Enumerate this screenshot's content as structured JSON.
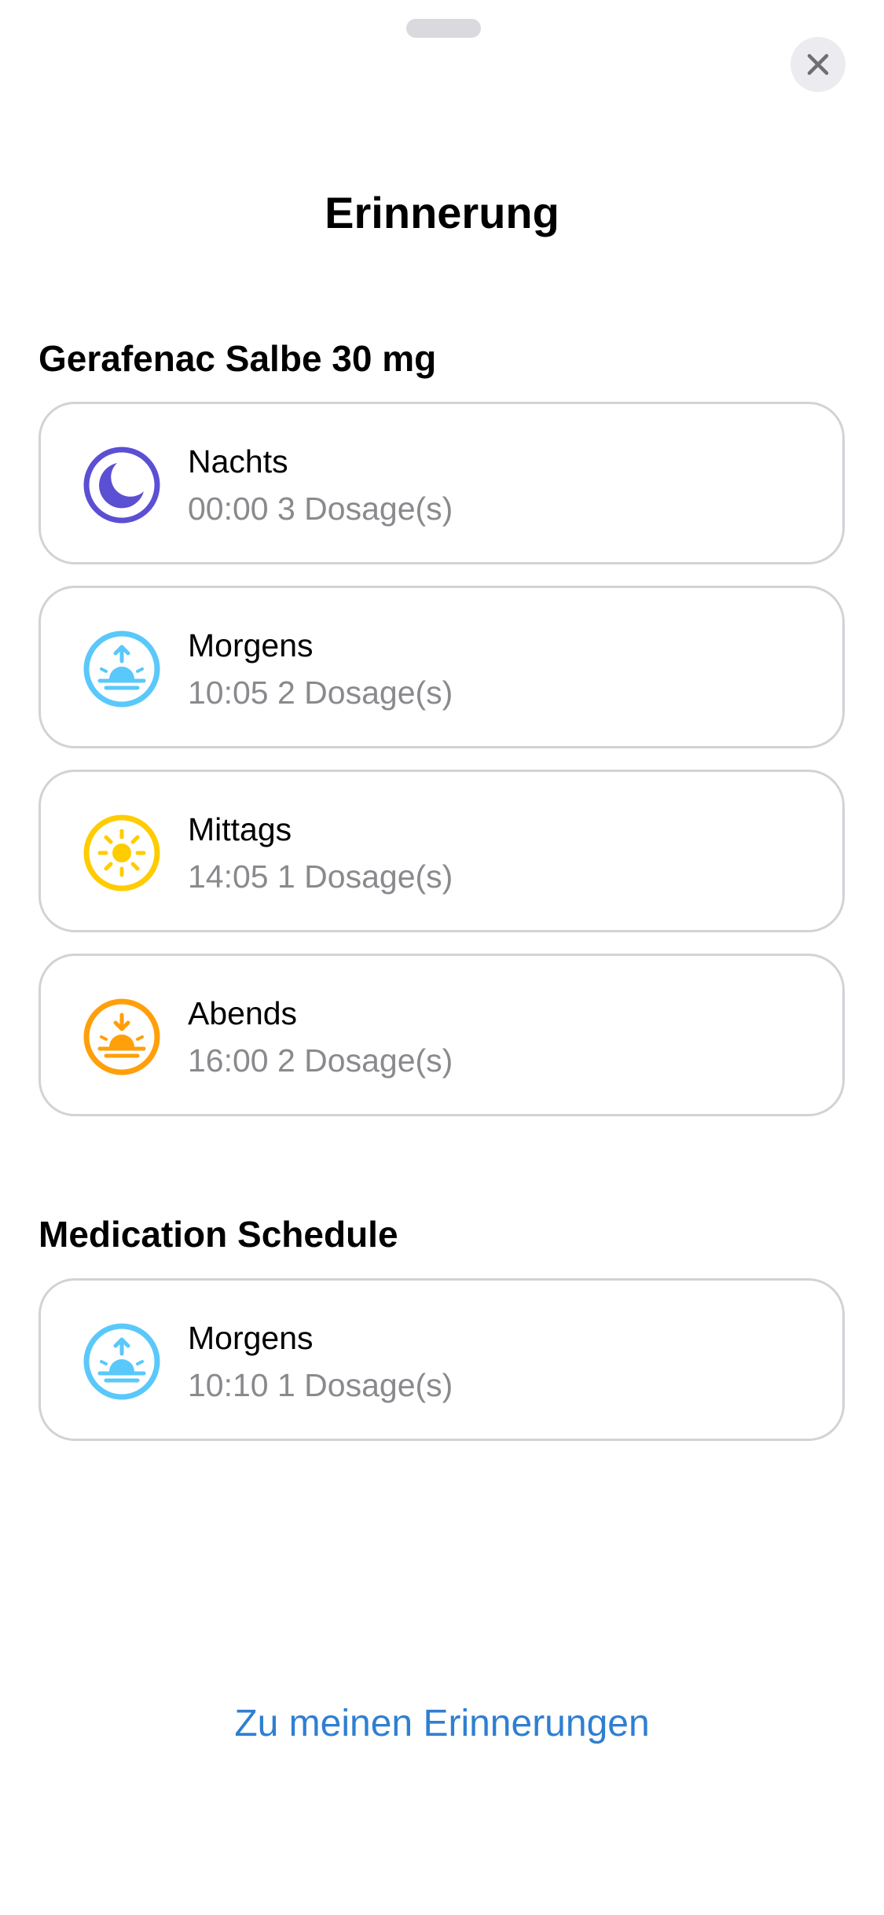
{
  "header": {
    "title": "Erinnerung"
  },
  "sections": [
    {
      "title": "Gerafenac Salbe 30 mg",
      "items": [
        {
          "label": "Nachts",
          "detail": "00:00 3 Dosage(s)",
          "icon": "moon-icon",
          "color": "#5b4fd4"
        },
        {
          "label": "Morgens",
          "detail": "10:05 2 Dosage(s)",
          "icon": "sunrise-icon",
          "color": "#5ac8fa"
        },
        {
          "label": "Mittags",
          "detail": "14:05 1 Dosage(s)",
          "icon": "sun-icon",
          "color": "#ffcc00"
        },
        {
          "label": "Abends",
          "detail": "16:00 2 Dosage(s)",
          "icon": "sunset-icon",
          "color": "#ff9f0a"
        }
      ]
    },
    {
      "title": "Medication Schedule",
      "items": [
        {
          "label": "Morgens",
          "detail": "10:10 1 Dosage(s)",
          "icon": "sunrise-icon",
          "color": "#5ac8fa"
        }
      ]
    }
  ],
  "footer": {
    "link_label": "Zu meinen Erinnerungen",
    "link_color": "#2f7fd0"
  },
  "icons": {
    "close": "close-icon"
  }
}
